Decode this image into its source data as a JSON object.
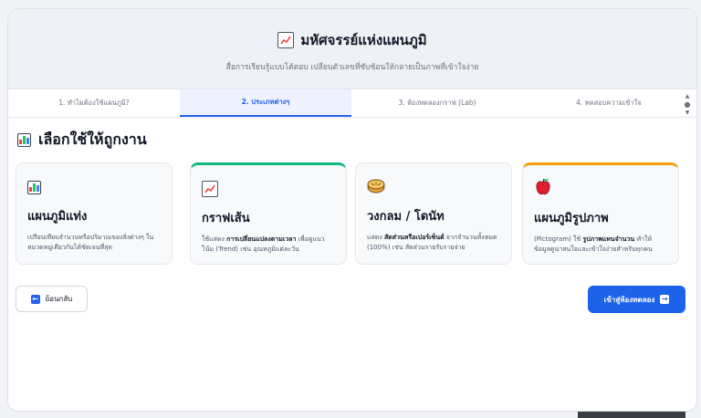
{
  "header": {
    "title": "มหัศจรรย์แห่งแผนภูมิ",
    "subtitle": "สื่อการเรียนรู้แบบโต้ตอบ เปลี่ยนตัวเลขที่ซับซ้อนให้กลายเป็นภาพที่เข้าใจง่าย",
    "icon": "line-chart-icon"
  },
  "tabs": [
    {
      "label": "1. ทำไมต้องใช้แผนภูมิ?",
      "active": false
    },
    {
      "label": "2. ประเภทต่างๆ",
      "active": true
    },
    {
      "label": "3. ห้องทดลองกราฟ (Lab)",
      "active": false
    },
    {
      "label": "4. ทดสอบความเข้าใจ",
      "active": false
    }
  ],
  "section": {
    "title": "เลือกใช้ให้ถูกงาน",
    "icon": "bar-chart-icon"
  },
  "cards": [
    {
      "icon": "bar-chart-icon",
      "heading": "แผนภูมิแท่ง",
      "text_before": "เปรียบเทียบจำนวนหรือปริมาณของสิ่งต่างๆ ในหมวดหมู่เดียวกันได้ชัดเจนที่สุด",
      "text_bold": "",
      "text_after": ""
    },
    {
      "icon": "line-chart-icon",
      "heading": "กราฟเส้น",
      "text_before": "ใช้แสดง ",
      "text_bold": "การเปลี่ยนแปลงตามเวลา",
      "text_after": " เพื่อดูแนวโน้ม (Trend) เช่น อุณหภูมิแต่ละวัน"
    },
    {
      "icon": "pie-icon",
      "heading": "วงกลม / โดนัท",
      "text_before": "แสดง ",
      "text_bold": "สัดส่วนหรือเปอร์เซ็นต์",
      "text_after": " จากจำนวนทั้งหมด (100%) เช่น สัดส่วนรายรับรายจ่าย"
    },
    {
      "icon": "apple-icon",
      "heading": "แผนภูมิรูปภาพ",
      "text_before": "(Pictogram) ใช้ ",
      "text_bold": "รูปภาพแทนจำนวน",
      "text_after": " ทำให้ข้อมูลดูน่าสนใจและเข้าใจง่ายสำหรับทุกคน"
    }
  ],
  "buttons": {
    "back": "ย้อนกลับ",
    "next": "เข้าสู่ห้องทดลอง"
  },
  "colors": {
    "accent": "#1d63ea",
    "green_highlight": "#10b981",
    "orange_highlight": "#f59e0b"
  }
}
